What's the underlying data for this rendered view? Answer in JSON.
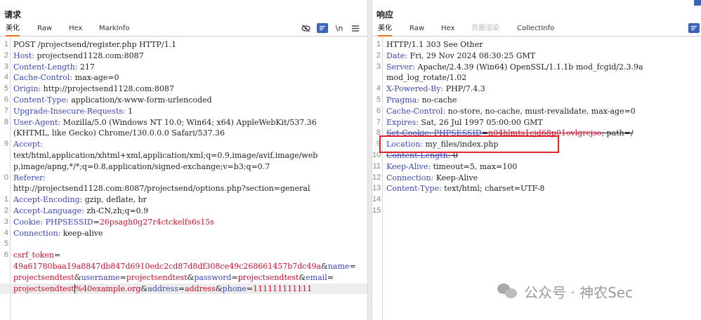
{
  "request": {
    "title": "请求",
    "tabs": [
      "美化",
      "Raw",
      "Hex",
      "MarkInfo"
    ],
    "icons": [
      "eye-off-icon",
      "wrap-icon",
      "newline-icon",
      "menu-icon"
    ],
    "lines": [
      {
        "n": "1",
        "parts": [
          [
            "plain",
            "POST /projectsend/register.php HTTP/1.1"
          ]
        ]
      },
      {
        "n": "2",
        "parts": [
          [
            "hk",
            "Host:"
          ],
          [
            "hv",
            " projectsend1128.com:8087"
          ]
        ]
      },
      {
        "n": "3",
        "parts": [
          [
            "hk",
            "Content-Length:"
          ],
          [
            "hv",
            " 217"
          ]
        ]
      },
      {
        "n": "4",
        "parts": [
          [
            "hk",
            "Cache-Control:"
          ],
          [
            "hv",
            " max-age=0"
          ]
        ]
      },
      {
        "n": "5",
        "parts": [
          [
            "hk",
            "Origin:"
          ],
          [
            "hv",
            " http://projectsend1128.com:8087"
          ]
        ]
      },
      {
        "n": "6",
        "parts": [
          [
            "hk",
            "Content-Type:"
          ],
          [
            "hv",
            " application/x-www-form-urlencoded"
          ]
        ]
      },
      {
        "n": "7",
        "parts": [
          [
            "hk",
            "Upgrade-Insecure-Requests:"
          ],
          [
            "hv",
            " 1"
          ]
        ]
      },
      {
        "n": "8",
        "parts": [
          [
            "hk",
            "User-Agent:"
          ],
          [
            "hv",
            " Mozilla/5.0 (Windows NT 10.0; Win64; x64) AppleWebKit/537.36"
          ]
        ]
      },
      {
        "n": "",
        "parts": [
          [
            "hv",
            "(KHTML, like Gecko) Chrome/130.0.0.0 Safari/537.36"
          ]
        ]
      },
      {
        "n": "9",
        "parts": [
          [
            "hk",
            "Accept:"
          ]
        ]
      },
      {
        "n": "",
        "parts": [
          [
            "hv",
            "text/html,application/xhtml+xml,application/xml;q=0.9,image/avif,image/web"
          ]
        ]
      },
      {
        "n": "",
        "parts": [
          [
            "hv",
            "p,image/apng,*/*;q=0.8,application/signed-exchange;v=b3;q=0.7"
          ]
        ]
      },
      {
        "n": "0",
        "parts": [
          [
            "hk",
            "Referer:"
          ]
        ]
      },
      {
        "n": "",
        "parts": [
          [
            "hv",
            "http://projectsend1128.com:8087/projectsend/options.php?section=general"
          ]
        ]
      },
      {
        "n": "1",
        "parts": [
          [
            "hk",
            "Accept-Encoding:"
          ],
          [
            "hv",
            " gzip, deflate, br"
          ]
        ]
      },
      {
        "n": "2",
        "parts": [
          [
            "hk",
            "Accept-Language:"
          ],
          [
            "hv",
            " zh-CN,zh;q=0.9"
          ]
        ]
      },
      {
        "n": "3",
        "parts": [
          [
            "hk",
            "Cookie:"
          ],
          [
            "hv",
            " "
          ],
          [
            "hk",
            "PHPSESSID"
          ],
          [
            "hv",
            "="
          ],
          [
            "pv",
            "26psagh0g27r4ctckelfs6s15s"
          ]
        ]
      },
      {
        "n": "4",
        "parts": [
          [
            "hk",
            "Connection:"
          ],
          [
            "hv",
            " keep-alive"
          ]
        ]
      },
      {
        "n": "5",
        "parts": []
      },
      {
        "n": "6",
        "parts": [
          [
            "pk",
            "csrf_token"
          ],
          [
            "plain",
            "="
          ]
        ]
      },
      {
        "n": "",
        "parts": [
          [
            "pv",
            "49a61780baa19a8847db847d6910edc2cd87d8df308ce49c268661457b7dc49a"
          ],
          [
            "plain",
            "&"
          ],
          [
            "hk",
            "name"
          ],
          [
            "plain",
            "="
          ]
        ]
      },
      {
        "n": "",
        "parts": [
          [
            "pv",
            "projectsendtest"
          ],
          [
            "plain",
            "&"
          ],
          [
            "hk",
            "username"
          ],
          [
            "plain",
            "="
          ],
          [
            "pv",
            "projectsendtest"
          ],
          [
            "plain",
            "&"
          ],
          [
            "hk",
            "password"
          ],
          [
            "plain",
            "="
          ],
          [
            "pv",
            "projectsendtest"
          ],
          [
            "plain",
            "&"
          ],
          [
            "hk",
            "email"
          ],
          [
            "plain",
            "="
          ]
        ]
      },
      {
        "n": "",
        "parts": [
          [
            "pv",
            "projectsendtest"
          ],
          [
            "pv",
            "%40example.org"
          ],
          [
            "plain",
            "&"
          ],
          [
            "hk",
            "address"
          ],
          [
            "plain",
            "="
          ],
          [
            "pv",
            "address"
          ],
          [
            "plain",
            "&"
          ],
          [
            "hk",
            "phone"
          ],
          [
            "plain",
            "="
          ],
          [
            "pv",
            "111111111111"
          ]
        ]
      }
    ]
  },
  "response": {
    "title": "响应",
    "tabs": [
      "美化",
      "Raw",
      "Hex",
      "页面渲染",
      "CollectInfo"
    ],
    "icons": [
      "wrap-icon"
    ],
    "lines": [
      {
        "n": "1",
        "parts": [
          [
            "plain",
            "HTTP/1.1 303 See Other"
          ]
        ]
      },
      {
        "n": "2",
        "parts": [
          [
            "hk",
            "Date:"
          ],
          [
            "hv",
            " Fri, 29 Nov 2024 08:30:25 GMT"
          ]
        ]
      },
      {
        "n": "3",
        "parts": [
          [
            "hk",
            "Server:"
          ],
          [
            "hv",
            " Apache/2.4.39 (Win64) OpenSSL/1.1.1b mod_fcgid/2.3.9a"
          ]
        ]
      },
      {
        "n": "",
        "parts": [
          [
            "hv",
            "mod_log_rotate/1.02"
          ]
        ]
      },
      {
        "n": "4",
        "parts": [
          [
            "hk",
            "X-Powered-By:"
          ],
          [
            "hv",
            " PHP/7.4.3"
          ]
        ]
      },
      {
        "n": "5",
        "parts": [
          [
            "hk",
            "Pragma:"
          ],
          [
            "hv",
            " no-cache"
          ]
        ]
      },
      {
        "n": "6",
        "parts": [
          [
            "hk",
            "Cache-Control:"
          ],
          [
            "hv",
            " no-store, no-cache, must-revalidate, max-age=0"
          ]
        ]
      },
      {
        "n": "7",
        "parts": [
          [
            "hk",
            "Expires:"
          ],
          [
            "hv",
            " Sat, 26 Jul 1997 05:00:00 GMT"
          ]
        ]
      },
      {
        "n": "8",
        "parts": [
          [
            "hk",
            "Set-Cookie:"
          ],
          [
            "hv",
            " "
          ],
          [
            "hk",
            "PHPSESSID"
          ],
          [
            "hv",
            "="
          ],
          [
            "pv",
            "n04hlmts1cjd68p01ovlgrcjso"
          ],
          [
            "hv",
            "; path=/"
          ]
        ]
      },
      {
        "n": "9",
        "parts": [
          [
            "hk",
            "Location:"
          ],
          [
            "hv",
            " my_files/index.php"
          ]
        ]
      },
      {
        "n": "10",
        "parts": [
          [
            "hk",
            "Content-Length:"
          ],
          [
            "hv",
            " 0"
          ]
        ]
      },
      {
        "n": "11",
        "parts": [
          [
            "hk",
            "Keep-Alive:"
          ],
          [
            "hv",
            " timeout=5, max=100"
          ]
        ]
      },
      {
        "n": "12",
        "parts": [
          [
            "hk",
            "Connection:"
          ],
          [
            "hv",
            " Keep-Alive"
          ]
        ]
      },
      {
        "n": "13",
        "parts": [
          [
            "hk",
            "Content-Type:"
          ],
          [
            "hv",
            " text/html; charset=UTF-8"
          ]
        ]
      },
      {
        "n": "14",
        "parts": []
      },
      {
        "n": "15",
        "parts": []
      }
    ]
  },
  "watermark": {
    "text": "公众号 · 神农Sec",
    "icon": "wechat-icon"
  },
  "colors": {
    "header_key": "#3c45b8",
    "param_value": "#c8102e",
    "active_tab": "#e8731a",
    "highlight_box": "#e0242a",
    "icon_blue": "#3b63b8"
  }
}
